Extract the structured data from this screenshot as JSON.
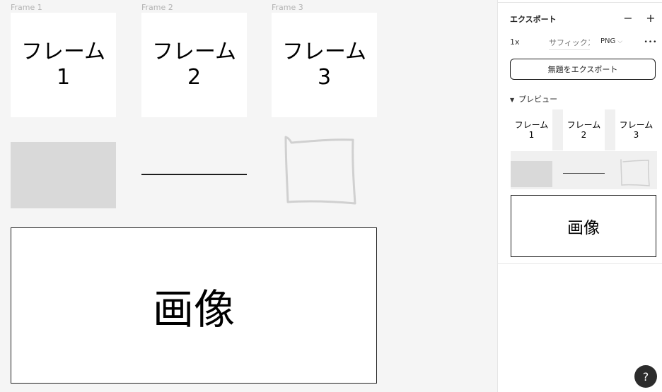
{
  "canvas": {
    "frames": [
      {
        "label": "Frame 1",
        "text_line1": "フレーム",
        "text_line2": "1"
      },
      {
        "label": "Frame 2",
        "text_line1": "フレーム",
        "text_line2": "2"
      },
      {
        "label": "Frame 3",
        "text_line1": "フレーム",
        "text_line2": "3"
      }
    ],
    "image_text": "画像"
  },
  "export_panel": {
    "title": "エクスポート",
    "remove_icon": "minus-icon",
    "add_icon": "plus-icon",
    "remove_glyph": "−",
    "add_glyph": "+",
    "scale": "1x",
    "suffix_placeholder": "サフィックス",
    "format": "PNG",
    "more_glyph": "•••",
    "export_button": "無題をエクスポート",
    "preview_label": "プレビュー",
    "preview_thumbs": [
      {
        "line1": "フレーム",
        "line2": "1"
      },
      {
        "line1": "フレーム",
        "line2": "2"
      },
      {
        "line1": "フレーム",
        "line2": "3"
      }
    ],
    "preview_image_text": "画像"
  },
  "help": {
    "glyph": "?"
  }
}
